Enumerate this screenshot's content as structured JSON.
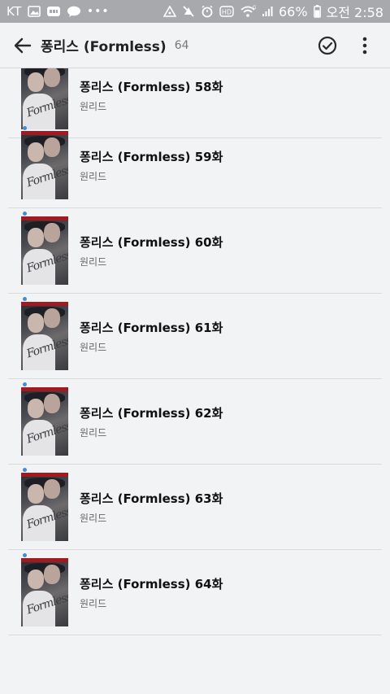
{
  "status_bar": {
    "carrier": "KT",
    "battery": "66%",
    "time": "오전 2:58"
  },
  "toolbar": {
    "title": "퐁리스 (Formless)",
    "count": "64"
  },
  "episodes": [
    {
      "title": "퐁리스 (Formless) 58화",
      "status": "원리드",
      "new_dot": false
    },
    {
      "title": "퐁리스 (Formless) 59화",
      "status": "원리드",
      "new_dot": true
    },
    {
      "title": "퐁리스 (Formless) 60화",
      "status": "원리드",
      "new_dot": true
    },
    {
      "title": "퐁리스 (Formless) 61화",
      "status": "원리드",
      "new_dot": true
    },
    {
      "title": "퐁리스 (Formless) 62화",
      "status": "원리드",
      "new_dot": true
    },
    {
      "title": "퐁리스 (Formless) 63화",
      "status": "원리드",
      "new_dot": true
    },
    {
      "title": "퐁리스 (Formless) 64화",
      "status": "원리드",
      "new_dot": true
    }
  ],
  "cover_lettering": "Formless",
  "colors": {
    "background": "#f2f3f5",
    "status_bar": "#a7a9ad",
    "new_dot": "#3b8fd4",
    "cover_accent": "#a11a1f"
  },
  "icons": [
    "back-arrow-icon",
    "check-circle-icon",
    "more-vert-icon",
    "gallery-icon",
    "bbc-icon",
    "chat-icon",
    "signal-icon",
    "mute-icon",
    "alarm-icon",
    "hd-icon",
    "wifi-icon",
    "battery-icon"
  ]
}
